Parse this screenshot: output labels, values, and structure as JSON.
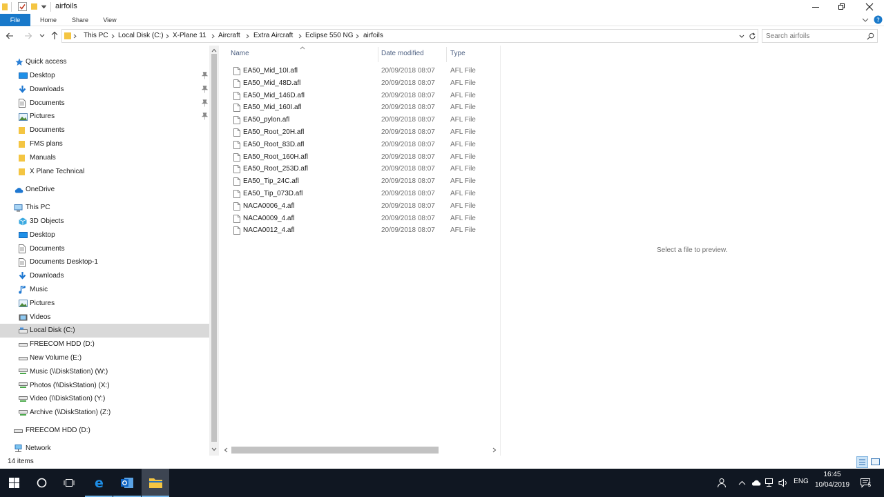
{
  "window": {
    "title": "airfoils",
    "min_icon": "minimize-icon",
    "max_icon": "restore-icon",
    "close_icon": "close-icon"
  },
  "ribbon": {
    "tabs": [
      "File",
      "Home",
      "Share",
      "View"
    ]
  },
  "address": {
    "crumbs": [
      "This PC",
      "Local Disk (C:)",
      "X-Plane 11",
      "Aircraft",
      "Extra Aircraft",
      "Eclipse 550 NG",
      "airfoils"
    ],
    "search_placeholder": "Search airfoils"
  },
  "nav": {
    "quick_access": "Quick access",
    "quick_items": [
      {
        "label": "Desktop",
        "icon": "desktop-icon",
        "pinned": true
      },
      {
        "label": "Downloads",
        "icon": "download-icon",
        "pinned": true
      },
      {
        "label": "Documents",
        "icon": "document-icon",
        "pinned": true
      },
      {
        "label": "Pictures",
        "icon": "picture-icon",
        "pinned": true
      },
      {
        "label": "Documents",
        "icon": "folder-icon",
        "pinned": false
      },
      {
        "label": "FMS plans",
        "icon": "folder-icon",
        "pinned": false
      },
      {
        "label": "Manuals",
        "icon": "folder-icon",
        "pinned": false
      },
      {
        "label": "X Plane Technical",
        "icon": "folder-icon",
        "pinned": false
      }
    ],
    "onedrive": "OneDrive",
    "this_pc": "This PC",
    "pc_items": [
      {
        "label": "3D Objects",
        "icon": "cube-icon"
      },
      {
        "label": "Desktop",
        "icon": "desktop-icon"
      },
      {
        "label": "Documents",
        "icon": "document-icon"
      },
      {
        "label": "Documents Desktop-1",
        "icon": "document-icon"
      },
      {
        "label": "Downloads",
        "icon": "download-icon"
      },
      {
        "label": "Music",
        "icon": "music-icon"
      },
      {
        "label": "Pictures",
        "icon": "picture-icon"
      },
      {
        "label": "Videos",
        "icon": "video-icon"
      },
      {
        "label": "Local Disk (C:)",
        "icon": "disk-icon",
        "selected": true
      },
      {
        "label": "FREECOM HDD (D:)",
        "icon": "drive-icon"
      },
      {
        "label": "New Volume (E:)",
        "icon": "drive-icon"
      },
      {
        "label": "Music (\\\\DiskStation) (W:)",
        "icon": "network-drive-icon"
      },
      {
        "label": "Photos (\\\\DiskStation) (X:)",
        "icon": "network-drive-icon"
      },
      {
        "label": "Video (\\\\DiskStation) (Y:)",
        "icon": "network-drive-icon"
      },
      {
        "label": "Archive (\\\\DiskStation) (Z:)",
        "icon": "network-drive-icon"
      }
    ],
    "freecom": "FREECOM HDD (D:)",
    "network": "Network"
  },
  "files": {
    "columns": [
      "Name",
      "Date modified",
      "Type"
    ],
    "rows": [
      {
        "name": "EA50_Mid_10I.afl",
        "date": "20/09/2018 08:07",
        "type": "AFL File"
      },
      {
        "name": "EA50_Mid_48D.afl",
        "date": "20/09/2018 08:07",
        "type": "AFL File"
      },
      {
        "name": "EA50_Mid_146D.afl",
        "date": "20/09/2018 08:07",
        "type": "AFL File"
      },
      {
        "name": "EA50_Mid_160I.afl",
        "date": "20/09/2018 08:07",
        "type": "AFL File"
      },
      {
        "name": "EA50_pylon.afl",
        "date": "20/09/2018 08:07",
        "type": "AFL File"
      },
      {
        "name": "EA50_Root_20H.afl",
        "date": "20/09/2018 08:07",
        "type": "AFL File"
      },
      {
        "name": "EA50_Root_83D.afl",
        "date": "20/09/2018 08:07",
        "type": "AFL File"
      },
      {
        "name": "EA50_Root_160H.afl",
        "date": "20/09/2018 08:07",
        "type": "AFL File"
      },
      {
        "name": "EA50_Root_253D.afl",
        "date": "20/09/2018 08:07",
        "type": "AFL File"
      },
      {
        "name": "EA50_Tip_24C.afl",
        "date": "20/09/2018 08:07",
        "type": "AFL File"
      },
      {
        "name": "EA50_Tip_073D.afl",
        "date": "20/09/2018 08:07",
        "type": "AFL File"
      },
      {
        "name": "NACA0006_4.afl",
        "date": "20/09/2018 08:07",
        "type": "AFL File"
      },
      {
        "name": "NACA0009_4.afl",
        "date": "20/09/2018 08:07",
        "type": "AFL File"
      },
      {
        "name": "NACA0012_4.afl",
        "date": "20/09/2018 08:07",
        "type": "AFL File"
      }
    ]
  },
  "preview": {
    "message": "Select a file to preview."
  },
  "status": {
    "item_count": "14 items"
  },
  "taskbar": {
    "lang": "ENG",
    "time": "16:45",
    "date": "10/04/2019",
    "notification_count": "5",
    "colors": {
      "bg": "#101722",
      "active": "#3d4552",
      "accent": "#1979ca"
    }
  }
}
